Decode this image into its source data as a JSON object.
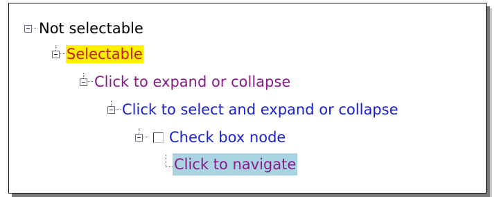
{
  "tree": {
    "nodes": [
      {
        "label": "Not selectable",
        "expand_icon": "minus-box-icon"
      },
      {
        "label": "Selectable",
        "expand_icon": "minus-box-icon"
      },
      {
        "label": "Click to expand or collapse",
        "expand_icon": "minus-box-icon"
      },
      {
        "label": "Click to select and expand or collapse",
        "expand_icon": "minus-box-icon"
      },
      {
        "label": "Check box node",
        "expand_icon": "minus-box-icon",
        "checked": false
      },
      {
        "label": "Click to navigate",
        "expand_icon": "tree-elbow"
      }
    ]
  },
  "colors": {
    "selected_background": "#fff100",
    "selected_text": "#c91b1b",
    "visited_link": "#8b1a8c",
    "link": "#1a21d4",
    "hover_background": "#a8d3e0"
  }
}
